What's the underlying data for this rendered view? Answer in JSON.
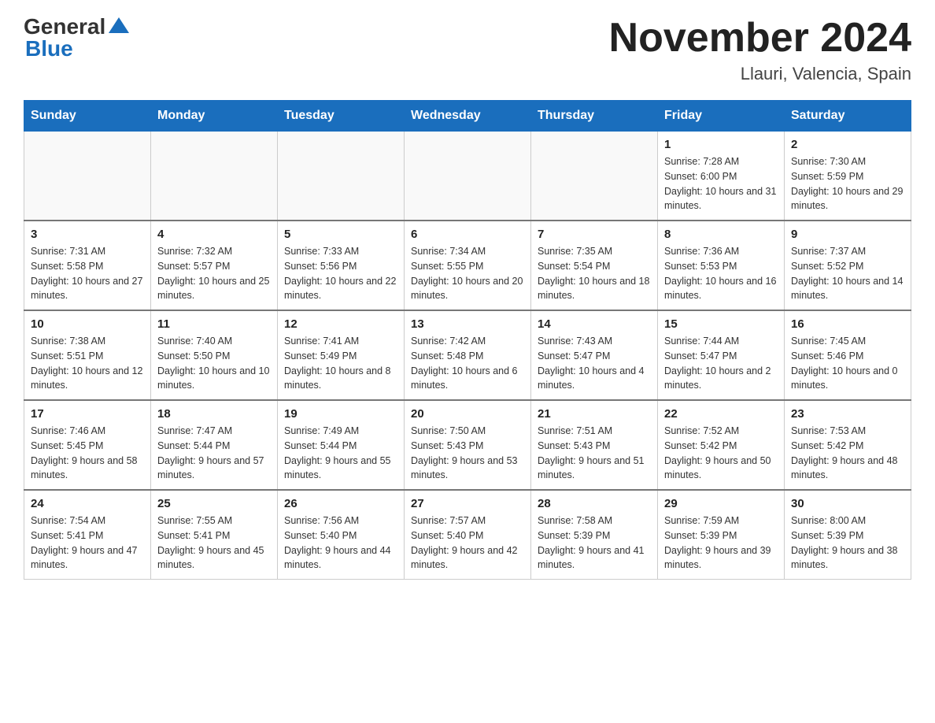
{
  "header": {
    "logo_general": "General",
    "logo_blue": "Blue",
    "main_title": "November 2024",
    "subtitle": "Llauri, Valencia, Spain"
  },
  "calendar": {
    "days_of_week": [
      "Sunday",
      "Monday",
      "Tuesday",
      "Wednesday",
      "Thursday",
      "Friday",
      "Saturday"
    ],
    "weeks": [
      [
        {
          "day": "",
          "info": ""
        },
        {
          "day": "",
          "info": ""
        },
        {
          "day": "",
          "info": ""
        },
        {
          "day": "",
          "info": ""
        },
        {
          "day": "",
          "info": ""
        },
        {
          "day": "1",
          "info": "Sunrise: 7:28 AM\nSunset: 6:00 PM\nDaylight: 10 hours and 31 minutes."
        },
        {
          "day": "2",
          "info": "Sunrise: 7:30 AM\nSunset: 5:59 PM\nDaylight: 10 hours and 29 minutes."
        }
      ],
      [
        {
          "day": "3",
          "info": "Sunrise: 7:31 AM\nSunset: 5:58 PM\nDaylight: 10 hours and 27 minutes."
        },
        {
          "day": "4",
          "info": "Sunrise: 7:32 AM\nSunset: 5:57 PM\nDaylight: 10 hours and 25 minutes."
        },
        {
          "day": "5",
          "info": "Sunrise: 7:33 AM\nSunset: 5:56 PM\nDaylight: 10 hours and 22 minutes."
        },
        {
          "day": "6",
          "info": "Sunrise: 7:34 AM\nSunset: 5:55 PM\nDaylight: 10 hours and 20 minutes."
        },
        {
          "day": "7",
          "info": "Sunrise: 7:35 AM\nSunset: 5:54 PM\nDaylight: 10 hours and 18 minutes."
        },
        {
          "day": "8",
          "info": "Sunrise: 7:36 AM\nSunset: 5:53 PM\nDaylight: 10 hours and 16 minutes."
        },
        {
          "day": "9",
          "info": "Sunrise: 7:37 AM\nSunset: 5:52 PM\nDaylight: 10 hours and 14 minutes."
        }
      ],
      [
        {
          "day": "10",
          "info": "Sunrise: 7:38 AM\nSunset: 5:51 PM\nDaylight: 10 hours and 12 minutes."
        },
        {
          "day": "11",
          "info": "Sunrise: 7:40 AM\nSunset: 5:50 PM\nDaylight: 10 hours and 10 minutes."
        },
        {
          "day": "12",
          "info": "Sunrise: 7:41 AM\nSunset: 5:49 PM\nDaylight: 10 hours and 8 minutes."
        },
        {
          "day": "13",
          "info": "Sunrise: 7:42 AM\nSunset: 5:48 PM\nDaylight: 10 hours and 6 minutes."
        },
        {
          "day": "14",
          "info": "Sunrise: 7:43 AM\nSunset: 5:47 PM\nDaylight: 10 hours and 4 minutes."
        },
        {
          "day": "15",
          "info": "Sunrise: 7:44 AM\nSunset: 5:47 PM\nDaylight: 10 hours and 2 minutes."
        },
        {
          "day": "16",
          "info": "Sunrise: 7:45 AM\nSunset: 5:46 PM\nDaylight: 10 hours and 0 minutes."
        }
      ],
      [
        {
          "day": "17",
          "info": "Sunrise: 7:46 AM\nSunset: 5:45 PM\nDaylight: 9 hours and 58 minutes."
        },
        {
          "day": "18",
          "info": "Sunrise: 7:47 AM\nSunset: 5:44 PM\nDaylight: 9 hours and 57 minutes."
        },
        {
          "day": "19",
          "info": "Sunrise: 7:49 AM\nSunset: 5:44 PM\nDaylight: 9 hours and 55 minutes."
        },
        {
          "day": "20",
          "info": "Sunrise: 7:50 AM\nSunset: 5:43 PM\nDaylight: 9 hours and 53 minutes."
        },
        {
          "day": "21",
          "info": "Sunrise: 7:51 AM\nSunset: 5:43 PM\nDaylight: 9 hours and 51 minutes."
        },
        {
          "day": "22",
          "info": "Sunrise: 7:52 AM\nSunset: 5:42 PM\nDaylight: 9 hours and 50 minutes."
        },
        {
          "day": "23",
          "info": "Sunrise: 7:53 AM\nSunset: 5:42 PM\nDaylight: 9 hours and 48 minutes."
        }
      ],
      [
        {
          "day": "24",
          "info": "Sunrise: 7:54 AM\nSunset: 5:41 PM\nDaylight: 9 hours and 47 minutes."
        },
        {
          "day": "25",
          "info": "Sunrise: 7:55 AM\nSunset: 5:41 PM\nDaylight: 9 hours and 45 minutes."
        },
        {
          "day": "26",
          "info": "Sunrise: 7:56 AM\nSunset: 5:40 PM\nDaylight: 9 hours and 44 minutes."
        },
        {
          "day": "27",
          "info": "Sunrise: 7:57 AM\nSunset: 5:40 PM\nDaylight: 9 hours and 42 minutes."
        },
        {
          "day": "28",
          "info": "Sunrise: 7:58 AM\nSunset: 5:39 PM\nDaylight: 9 hours and 41 minutes."
        },
        {
          "day": "29",
          "info": "Sunrise: 7:59 AM\nSunset: 5:39 PM\nDaylight: 9 hours and 39 minutes."
        },
        {
          "day": "30",
          "info": "Sunrise: 8:00 AM\nSunset: 5:39 PM\nDaylight: 9 hours and 38 minutes."
        }
      ]
    ]
  }
}
